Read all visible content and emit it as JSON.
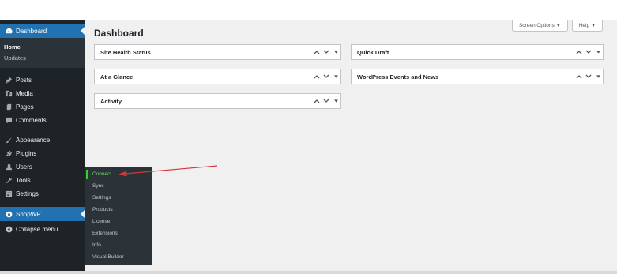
{
  "sidebar": {
    "dashboard": "Dashboard",
    "home": "Home",
    "updates": "Updates",
    "items": [
      {
        "label": "Posts",
        "icon": "pin-icon"
      },
      {
        "label": "Media",
        "icon": "media-icon"
      },
      {
        "label": "Pages",
        "icon": "pages-icon"
      },
      {
        "label": "Comments",
        "icon": "comments-icon"
      },
      {
        "label": "Appearance",
        "icon": "brush-icon"
      },
      {
        "label": "Plugins",
        "icon": "plugin-icon"
      },
      {
        "label": "Users",
        "icon": "users-icon"
      },
      {
        "label": "Tools",
        "icon": "wrench-icon"
      },
      {
        "label": "Settings",
        "icon": "settings-icon"
      },
      {
        "label": "ShopWP",
        "icon": "shopwp-icon"
      },
      {
        "label": "Collapse menu",
        "icon": "collapse-icon"
      }
    ]
  },
  "flyout": {
    "items": [
      "Connect",
      "Sync",
      "Settings",
      "Products",
      "License",
      "Extensions",
      "Info",
      "Visual Builder"
    ]
  },
  "header": {
    "title": "Dashboard",
    "screen_options": "Screen Options ▼",
    "help": "Help ▼"
  },
  "widgets": {
    "site_health": "Site Health Status",
    "at_a_glance": "At a Glance",
    "activity": "Activity",
    "quick_draft": "Quick Draft",
    "events": "WordPress Events and News"
  },
  "colors": {
    "sidebar_bg": "#1d2327",
    "active_bg": "#2271b1",
    "annotation": "#d63638",
    "highlight": "#30d230"
  }
}
